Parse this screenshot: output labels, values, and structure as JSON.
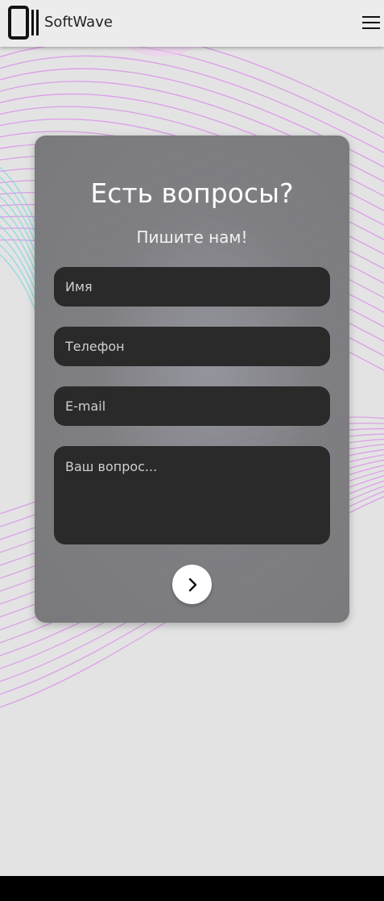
{
  "header": {
    "brand": "SoftWave",
    "logo_icon": "tablet-logo-icon",
    "menu_icon": "hamburger-menu-icon"
  },
  "form": {
    "title": "Есть вопросы?",
    "subtitle": "Пишите нам!",
    "name_placeholder": "Имя",
    "phone_placeholder": "Телефон",
    "email_placeholder": "E-mail",
    "question_placeholder": "Ваш вопрос...",
    "submit_icon": "chevron-right-icon"
  },
  "colors": {
    "card": "#7a7a7e",
    "field": "#2a2a2a",
    "wave_pink": "#d98be8",
    "wave_cyan": "#7fd6e0",
    "background": "#e3e3e3"
  }
}
